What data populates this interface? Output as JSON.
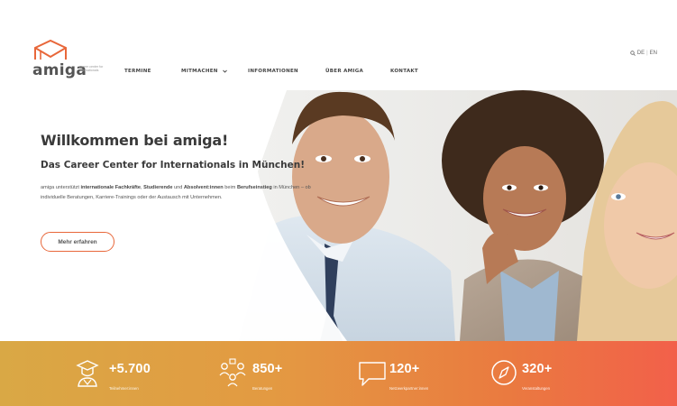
{
  "brand": {
    "name": "amiga",
    "tagline": "career center for internationals",
    "accent_color": "#e8673a",
    "logo_icon": "house-envelope-icon"
  },
  "nav": {
    "items": [
      {
        "label": "Termine"
      },
      {
        "label": "Mitmachen"
      },
      {
        "label": "Informationen"
      },
      {
        "label": "Über amiga"
      },
      {
        "label": "Kontakt"
      }
    ],
    "dropdown_icon": "chevron-down-icon"
  },
  "utility": {
    "search_icon": "search-icon",
    "lang_de": "DE",
    "separator": "|",
    "lang_en": "EN"
  },
  "hero": {
    "title": "Willkommen bei amiga!",
    "subtitle": "Das Career Center for Internationals in München!",
    "body": {
      "p1": "amiga unterstützt ",
      "b1": "internationale Fachkräfte",
      "p2": ", ",
      "b2": "Studierende",
      "p3": " und ",
      "b3": "Absolvent:innen",
      "p4": " beim ",
      "b4": "Berufseinstieg",
      "p5": " in München – ob individuelle Beratungen, Karriere-Trainings oder der Austausch mit Unternehmen."
    },
    "cta_label": "Mehr erfahren"
  },
  "stats": [
    {
      "icon": "graduate-icon",
      "value": "+5.700",
      "label": "Teilnehmer:innen"
    },
    {
      "icon": "network-people-icon",
      "value": "850+",
      "label": "Beratungen"
    },
    {
      "icon": "speech-bubble-icon",
      "value": "120+",
      "label": "Netzwerkpartner:innen"
    },
    {
      "icon": "compass-icon",
      "value": "320+",
      "label": "Veranstaltungen"
    }
  ],
  "colors": {
    "stats_gradient_start": "#d9a845",
    "stats_gradient_end": "#f2604a",
    "heading_text": "#3a3a3a"
  }
}
